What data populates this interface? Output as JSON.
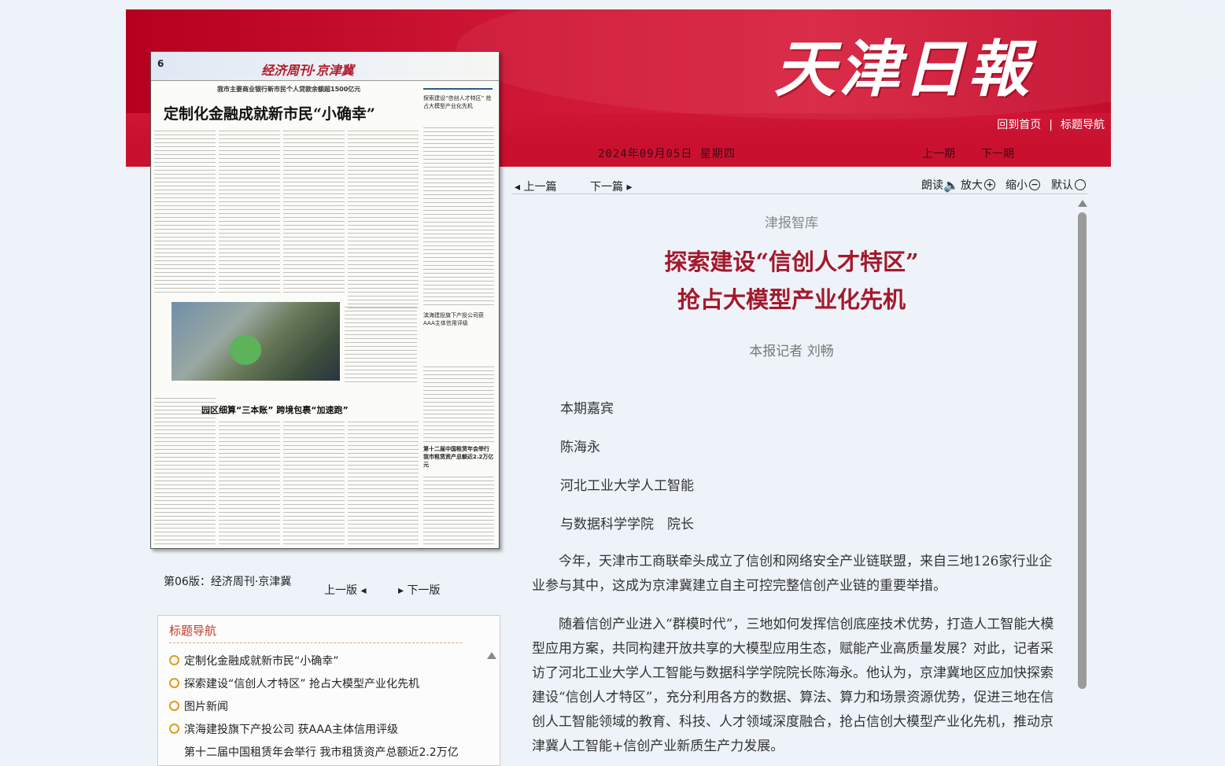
{
  "header": {
    "masthead": "天津日報",
    "home_link": "回到首页",
    "separator": "|",
    "nav_link": "标题导航",
    "date": "2024年09月05日 星期四",
    "prev_day": "上一期",
    "next_day": "下一期"
  },
  "newspaper_page": {
    "page_number": "6",
    "column_banner": "经济周刊·京津冀",
    "subheadline": "我市主要商业银行新市民个人贷款余额超1500亿元",
    "lead_title": "定制化金融成就新市民“小确幸”",
    "side_title": "探索建设“信创人才特区” 抢占大模型产业化先机",
    "mid_title": "园区细算“三本账” 跨境包裹“加速跑”",
    "side_title2": "滨海建投旗下产投公司获AAA主体信用评级",
    "side_title3": "第十二届中国租赁年会举行 我市租赁资产总额近2.2万亿元"
  },
  "page_nav": {
    "current_page": "第06版：经济周刊·京津冀",
    "prev_page": "上一版",
    "next_page": "下一版"
  },
  "headline_nav": {
    "title": "标题导航",
    "items": [
      "定制化金融成就新市民“小确幸”",
      "探索建设“信创人才特区” 抢占大模型产业化先机",
      "图片新闻",
      "滨海建投旗下产投公司 获AAA主体信用评级",
      "第十二届中国租赁年会举行 我市租赁资产总额近2.2万亿"
    ]
  },
  "toolbar": {
    "prev_article": "上一篇",
    "next_article": "下一篇",
    "read_aloud": "朗读",
    "zoom_in": "放大",
    "zoom_out": "缩小",
    "default": "默认"
  },
  "article": {
    "column": "津报智库",
    "headline_line1": "探索建设“信创人才特区”",
    "headline_line2": "抢占大模型产业化先机",
    "byline": "本报记者 刘畅",
    "guest_label": "本期嘉宾",
    "guest_name": "陈海永",
    "guest_org_line1": "河北工业大学人工智能",
    "guest_org_line2": "与数据科学学院　院长",
    "para1": "今年，天津市工商联牵头成立了信创和网络安全产业链联盟，来自三地126家行业企业参与其中，这成为京津冀建立自主可控完整信创产业链的重要举措。",
    "para2": "随着信创产业进入“群模时代”，三地如何发挥信创底座技术优势，打造人工智能大模型应用方案，共同构建开放共享的大模型应用生态，赋能产业高质量发展？对此，记者采访了河北工业大学人工智能与数据科学学院院长陈海永。他认为，京津冀地区应加快探索建设“信创人才特区”，充分利用各方的数据、算法、算力和场景资源优势，促进三地在信创人工智能领域的教育、科技、人才领域深度融合，抢占信创大模型产业化先机，推动京津冀人工智能+信创产业新质生产力发展。"
  }
}
